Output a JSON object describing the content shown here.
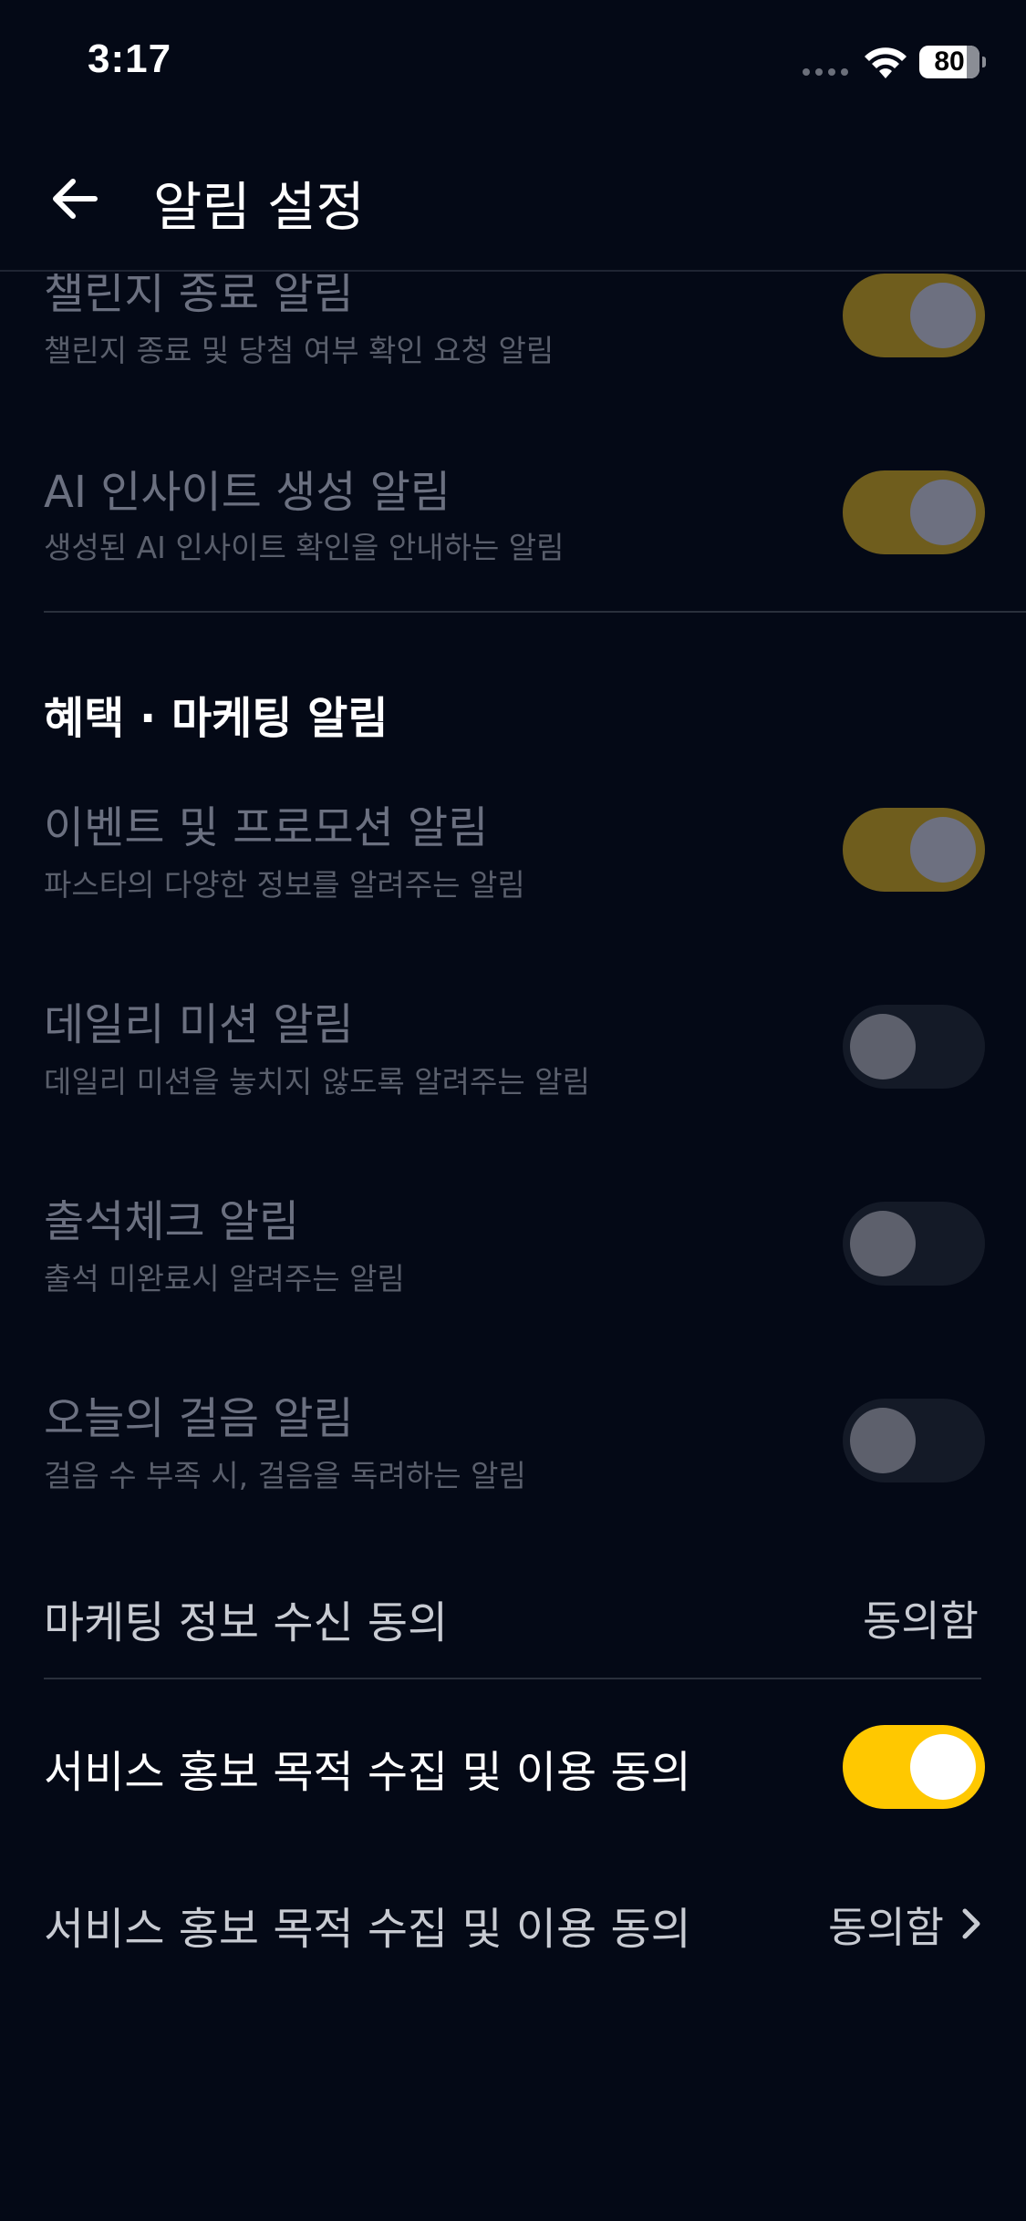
{
  "status_bar": {
    "time": "3:17",
    "battery": "80"
  },
  "header": {
    "title": "알림 설정"
  },
  "settings": {
    "challenge_end": {
      "title": "챌린지 종료 알림",
      "desc": "챌린지 종료 및 당첨 여부 확인 요청 알림"
    },
    "ai_insight": {
      "title": "AI 인사이트 생성 알림",
      "desc": "생성된 AI 인사이트 확인을 안내하는 알림"
    },
    "section_title": "혜택 · 마케팅 알림",
    "event_promo": {
      "title": "이벤트 및 프로모션 알림",
      "desc": "파스타의 다양한 정보를 알려주는 알림"
    },
    "daily_mission": {
      "title": "데일리 미션 알림",
      "desc": "데일리 미션을 놓치지 않도록 알려주는 알림"
    },
    "attendance": {
      "title": "출석체크 알림",
      "desc": "출석 미완료시 알려주는 알림"
    },
    "walking": {
      "title": "오늘의 걸음 알림",
      "desc": "걸음 수 부족 시, 걸음을 독려하는 알림"
    },
    "marketing_consent": {
      "label": "마케팅 정보 수신 동의",
      "value": "동의함"
    },
    "service_promo_toggle": {
      "label": "서비스 홍보 목적 수집 및 이용 동의"
    },
    "service_promo_link": {
      "label": "서비스 홍보 목적 수집 및 이용 동의",
      "value": "동의함"
    }
  },
  "colors": {
    "accent": "#ffc800",
    "background": "#040916"
  }
}
